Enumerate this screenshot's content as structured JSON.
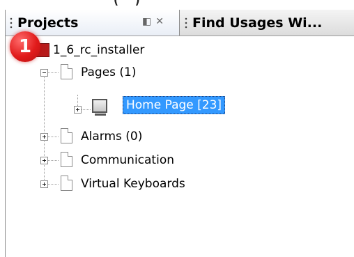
{
  "panel": {
    "tabs": [
      {
        "label": "Projects",
        "active": true
      },
      {
        "label": "Find Usages Wi...",
        "active": false
      }
    ],
    "tab_tools": [
      "minimize-icon",
      "close-icon"
    ]
  },
  "badge": {
    "number": "1",
    "color": "#e11b1b"
  },
  "tree": {
    "root": {
      "label": "1_6_rc_installer",
      "expanded": true
    },
    "items": [
      {
        "label": "Pages (1)",
        "expanded": true
      },
      {
        "label": "Home Page [23]",
        "selected": true,
        "expanded": false
      },
      {
        "label": "Alarms (0)",
        "expanded": false
      },
      {
        "label": "Communication",
        "expanded": false
      },
      {
        "label": "Virtual Keyboards",
        "expanded": false
      }
    ]
  },
  "colors": {
    "selection": "#3399ff",
    "project_icon": "#b71c1c"
  }
}
